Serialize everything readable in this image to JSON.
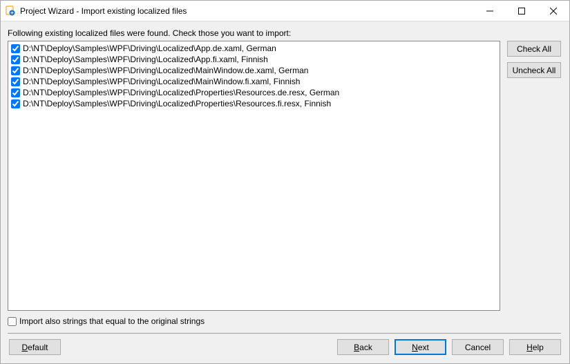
{
  "window": {
    "title": "Project Wizard - Import existing localized files"
  },
  "instruction": "Following existing localized files were found. Check those you want to import:",
  "files": [
    {
      "checked": true,
      "label": "D:\\NT\\Deploy\\Samples\\WPF\\Driving\\Localized\\App.de.xaml, German"
    },
    {
      "checked": true,
      "label": "D:\\NT\\Deploy\\Samples\\WPF\\Driving\\Localized\\App.fi.xaml, Finnish"
    },
    {
      "checked": true,
      "label": "D:\\NT\\Deploy\\Samples\\WPF\\Driving\\Localized\\MainWindow.de.xaml, German"
    },
    {
      "checked": true,
      "label": "D:\\NT\\Deploy\\Samples\\WPF\\Driving\\Localized\\MainWindow.fi.xaml, Finnish"
    },
    {
      "checked": true,
      "label": "D:\\NT\\Deploy\\Samples\\WPF\\Driving\\Localized\\Properties\\Resources.de.resx, German"
    },
    {
      "checked": true,
      "label": "D:\\NT\\Deploy\\Samples\\WPF\\Driving\\Localized\\Properties\\Resources.fi.resx, Finnish"
    }
  ],
  "side": {
    "check_all": "Check All",
    "uncheck_all": "Uncheck All"
  },
  "import_also_label": "Import also strings that equal to the original strings",
  "import_also_checked": false,
  "footer": {
    "default": "Default",
    "back": "Back",
    "next": "Next",
    "cancel": "Cancel",
    "help": "Help"
  }
}
